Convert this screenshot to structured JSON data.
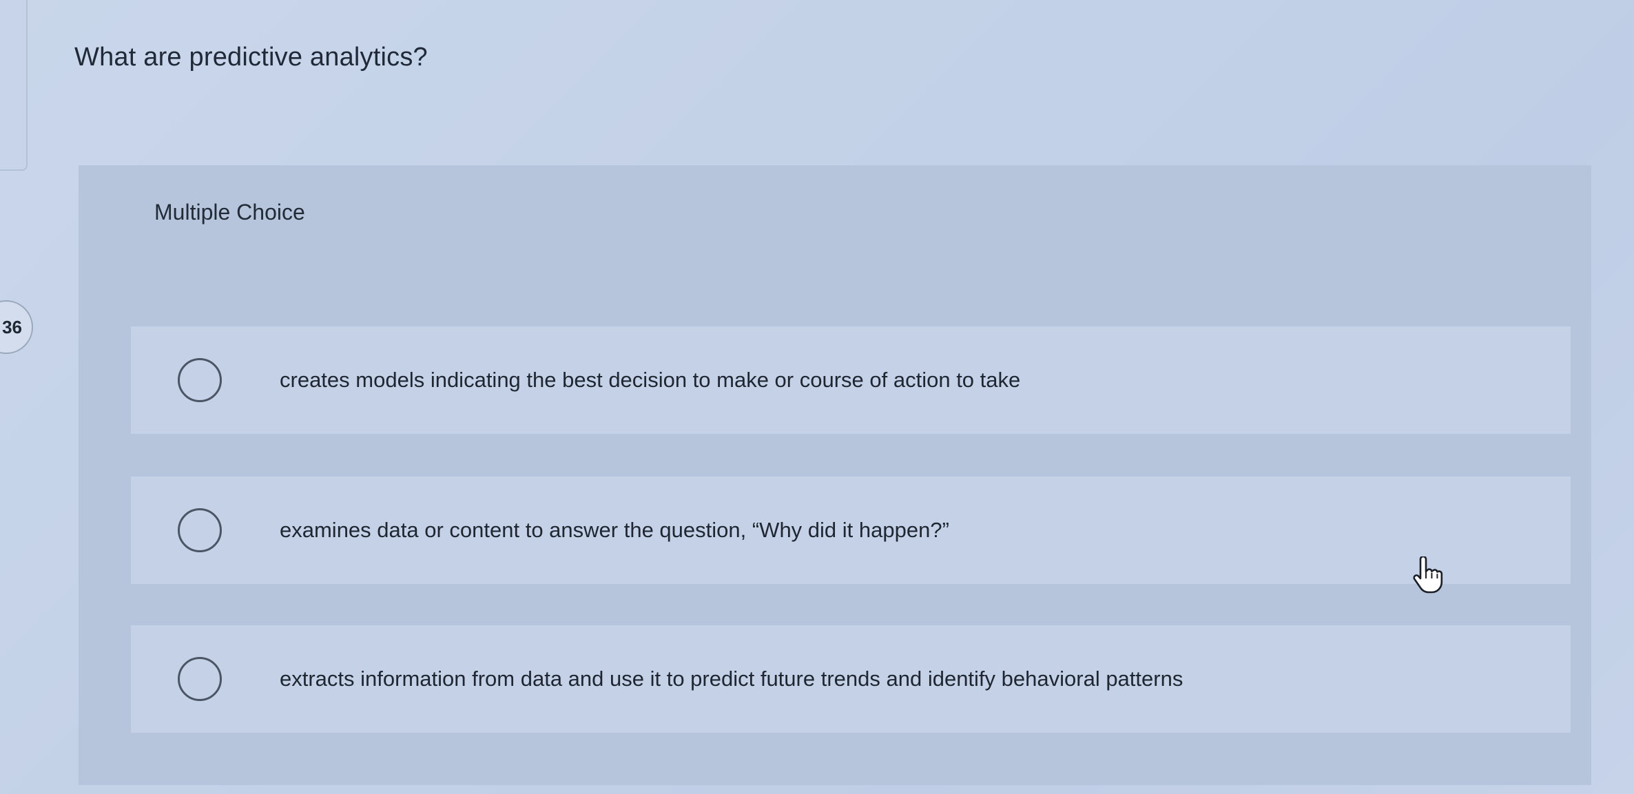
{
  "sidebar": {
    "question_number": "36"
  },
  "question": {
    "prompt": "What are predictive analytics?",
    "type_label": "Multiple Choice",
    "options": [
      {
        "text": "creates models indicating the best decision to make or course of action to take",
        "selected": false
      },
      {
        "text": "examines data or content to answer the question, “Why did it happen?”",
        "selected": false
      },
      {
        "text": "extracts information from data and use it to predict future trends and identify behavioral patterns",
        "selected": false
      }
    ]
  },
  "cursor": {
    "icon": "hand-pointer-icon"
  }
}
